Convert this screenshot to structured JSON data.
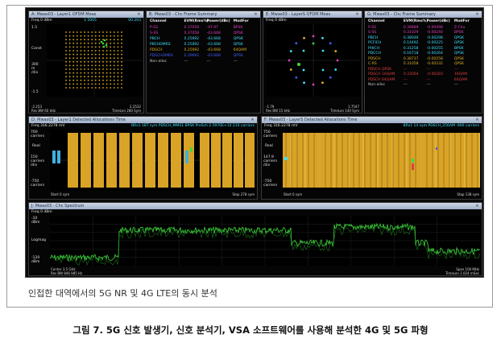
{
  "colors": {
    "accent_orange": "#d9a326",
    "trace_green": "#3fd83f",
    "cyan": "#40e0ff",
    "gold": "#e0b020",
    "magenta": "#e040c0",
    "blue": "#4060ff"
  },
  "win1": {
    "title": "A: Mwas03 - Layer1 OFDM Meas",
    "header_left": "Freq 0 dBm",
    "header_mid": "1 5005",
    "header_right": "00.203",
    "y_top": "1.5",
    "y_unit": "Const",
    "y_mid": "300\nm\n/div",
    "y_bot": "-1.5",
    "foot_left": "-2.253\nRes BW 60 kHz",
    "foot_right": "2.2532\nTimeLen 280 Sym"
  },
  "win2": {
    "title": "B: Mwas03 - Chc Frame Summary",
    "headers": [
      "Channel",
      "EVM(Rms%)",
      "Power(dBc)",
      "ModFor"
    ],
    "rows": [
      {
        "c1": "P-SS",
        "c2": "0.37058",
        "c3": "-47.97",
        "c4": "BPSK",
        "color": "#e040c0"
      },
      {
        "c1": "S-SS",
        "c2": "0.37058",
        "c3": "-43.668",
        "c4": "QPSK",
        "color": "#e040c0"
      },
      {
        "c1": "PBCH",
        "c2": "0.25692",
        "c3": "-43.668",
        "c4": "QPSK",
        "color": "#40e0ff"
      },
      {
        "c1": "PBCHDMRS",
        "c2": "0.25692",
        "c3": "-43.668",
        "c4": "QPSK",
        "color": "#40e0ff"
      },
      {
        "c1": "PDSCH",
        "c2": "0.25692",
        "c3": "-43.668",
        "c4": "64QAM",
        "color": "#e0b020"
      },
      {
        "c1": "PDSCHDMRS",
        "c2": "0.29692",
        "c3": "-43.668",
        "c4": "QPSK",
        "color": "#4060ff"
      },
      {
        "c1": "Non-alloc",
        "c2": "---",
        "c3": "---",
        "c4": "---",
        "color": "#c8c8c8"
      }
    ]
  },
  "win3": {
    "title": "E: Mwas03 - LayerS OFDM Meas",
    "header_left": "Freq 0 dBm",
    "foot_left": "-1.79\nRes BW 15 kHz",
    "foot_right": "1.7547\nTimeLen 140 Sym"
  },
  "win4": {
    "title": "G: Mwas03 - Chc Frame Summary",
    "headers": [
      "Channel",
      "EVM(Rms%)",
      "Power(dBc)",
      "ModFor"
    ],
    "rows": [
      {
        "c1": "P-SS",
        "c2": "0.39889",
        "c3": "-0.00498",
        "c4": "Z-Chu",
        "color": "#e040c0"
      },
      {
        "c1": "S-SS",
        "c2": "0.31029",
        "c3": "-0.00240",
        "c4": "BPSK",
        "color": "#e040c0"
      },
      {
        "c1": "PBCH",
        "c2": "0.38046",
        "c3": "-0.00298",
        "c4": "QPSK",
        "color": "#40e0ff"
      },
      {
        "c1": "PCFICH",
        "c2": "0.14492",
        "c3": "-0.00225",
        "c4": "QPSK",
        "color": "#40e0ff"
      },
      {
        "c1": "PHICH",
        "c2": "0.31258",
        "c3": "-0.00255",
        "c4": "BPSK",
        "color": "#40e0ff"
      },
      {
        "c1": "PDCCH",
        "c2": "0.16718",
        "c3": "-0.00264",
        "c4": "QPSK",
        "color": "#40e0ff"
      },
      {
        "c1": "PDSCH",
        "c2": "0.38737",
        "c3": "-0.00258",
        "c4": "QPSK",
        "color": "#e0b020"
      },
      {
        "c1": "C-RS",
        "c2": "0.31058",
        "c3": "-0.00232",
        "c4": "QPSK",
        "color": "#e0b020"
      },
      {
        "c1": "PDSCH QPSK",
        "c2": "---",
        "c3": "---",
        "c4": "---",
        "color": "#e04040"
      },
      {
        "c1": "PDSCH 16QAM",
        "c2": "0.33004",
        "c3": "-0.00283",
        "c4": "16QAM",
        "color": "#e04040"
      },
      {
        "c1": "PDSCH 64QAM",
        "c2": "---",
        "c3": "---",
        "c4": "64QAM",
        "color": "#e04040"
      },
      {
        "c1": "Non-alloc",
        "c2": "---",
        "c3": "---",
        "c4": "---",
        "color": "#c8c8c8"
      }
    ]
  },
  "win5": {
    "title": "D: Mwas03 - Layer1 Detected Allocations Time",
    "header_left": "Freq 316.2278 mV",
    "header_right": "BRs1   1BT sym PDSCH_MMS1  BPSK PreSch  2.5970E+10   210  carriers",
    "y_labels": [
      "760\ncarriers",
      "Real",
      "150\ncarriers\n/div",
      "-750\ncarriers"
    ],
    "foot_left": "Start 0 sym",
    "foot_right": "Stop 278 sym"
  },
  "win6": {
    "title": "F: Mwas03 - LayerS Detected Allocations Time",
    "header_left": "Freq 316.2278 mV",
    "header_right": "BRs1   14 sym PDSCH_256AM   -900  carriers",
    "y_labels": [
      "750\ncarriers",
      "Real",
      "147.9\ncarriers\n/div",
      "-750\ncarriers"
    ],
    "foot_left": "Start 0 sym",
    "foot_right": "Stop 138 sym"
  },
  "win7": {
    "title": "J: Mwas03 - Chc Spectrum",
    "header_left": "Freq 0 dBm",
    "y_labels": [
      "-10\ndBm",
      "Logmag",
      "-120\ndBm"
    ],
    "foot_left": "Center 3.5 GHz\nRes BW 846.985 Hz",
    "foot_right": "Span 100 MHz\nTimeLen 1.024 mSec"
  },
  "screen_caption": "인접한 대역에서의 5G NR 및 4G LTE의 동시 분석",
  "figure_caption": "그림 7. 5G 신호 발생기, 신호 분석기, VSA 소프트웨어를 사용해 분석한 4G 및 5G 파형"
}
